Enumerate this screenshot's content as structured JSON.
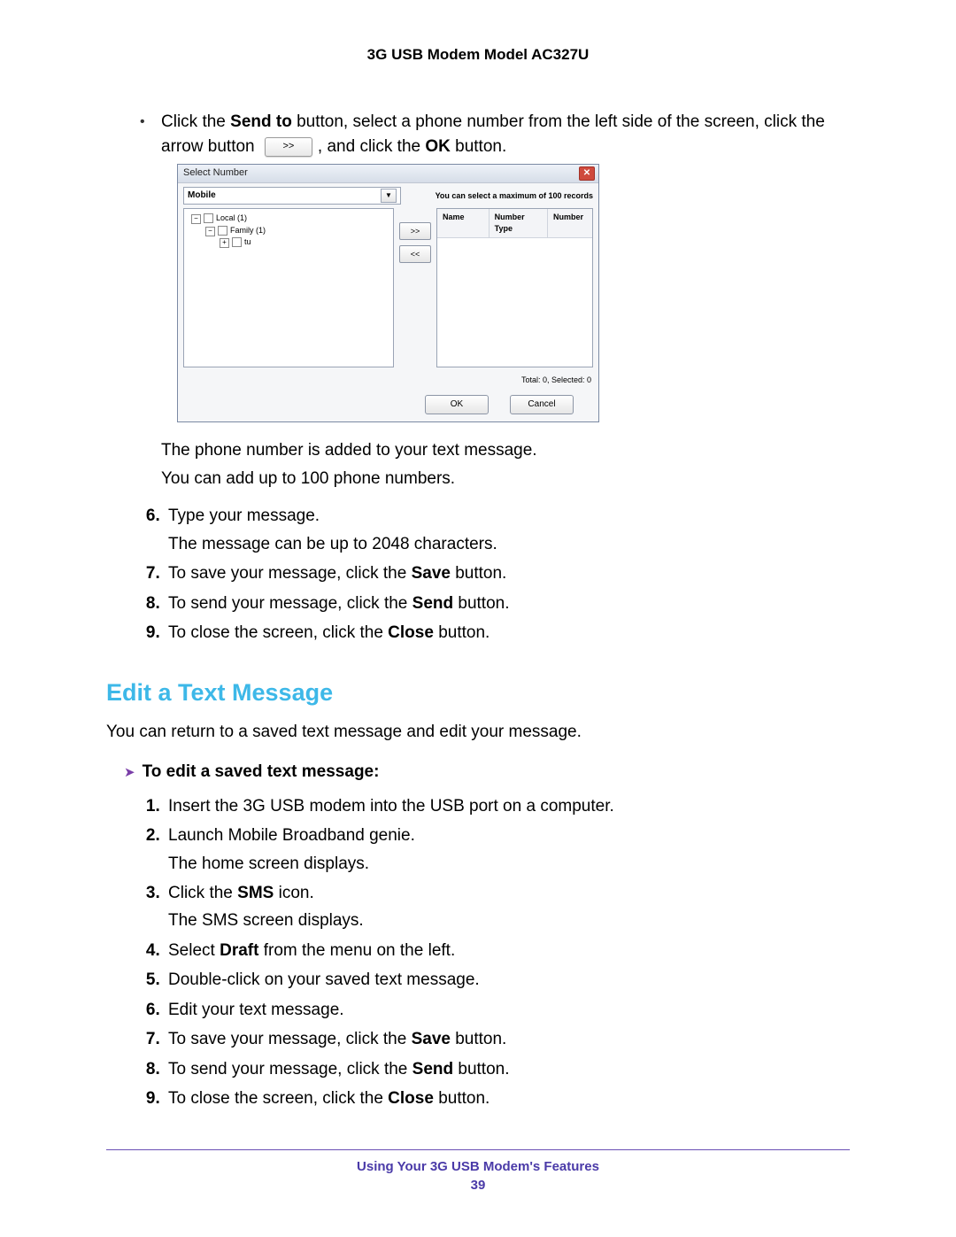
{
  "header": {
    "title": "3G USB Modem Model AC327U"
  },
  "intro_bullet": {
    "part1": "Click the ",
    "bold1": "Send to",
    "part2": " button, select a phone number from the left side of the screen, click the arrow button ",
    "part3": ", and click the ",
    "bold2": "OK",
    "part4": " button."
  },
  "dialog": {
    "title": "Select Number",
    "dropdown": "Mobile",
    "max_text": "You can select a maximum of  100 records",
    "tree": {
      "root": "Local (1)",
      "child": "Family (1)",
      "leaf": "tu"
    },
    "buttons": {
      "right": ">>",
      "left": "<<"
    },
    "cols": {
      "name": "Name",
      "type": "Number Type",
      "num": "Number"
    },
    "status": "Total: 0, Selected: 0",
    "ok": "OK",
    "cancel": "Cancel"
  },
  "post_dialog": {
    "l1": "The phone number is added to your text message.",
    "l2": "You can add up to 100 phone numbers."
  },
  "steps_a": {
    "s6a": "Type your message.",
    "s6b": "The message can be up to 2048 characters.",
    "s7a": "To save your message, click the ",
    "s7b": "Save",
    "s7c": " button.",
    "s8a": "To send your message, click the ",
    "s8b": "Send",
    "s8c": " button.",
    "s9a": "To close the screen, click the ",
    "s9b": "Close",
    "s9c": " button."
  },
  "section": {
    "heading": "Edit a Text Message",
    "intro": "You can return to a saved text message and edit your message."
  },
  "task": {
    "label": "To edit a saved text message:"
  },
  "steps_b": {
    "s1": "Insert the 3G USB modem into the USB port on a computer.",
    "s2a": "Launch Mobile Broadband genie.",
    "s2b": "The home screen displays.",
    "s3a": "Click the ",
    "s3b": "SMS",
    "s3c": " icon.",
    "s3d": "The SMS screen displays.",
    "s4a": "Select ",
    "s4b": "Draft",
    "s4c": " from the menu on the left.",
    "s5": "Double-click on your saved text message.",
    "s6": "Edit your text message.",
    "s7a": "To save your message, click the ",
    "s7b": "Save",
    "s7c": " button.",
    "s8a": "To send your message, click the ",
    "s8b": "Send",
    "s8c": " button.",
    "s9a": "To close the screen, click the ",
    "s9b": "Close",
    "s9c": " button."
  },
  "footer": {
    "text": "Using Your 3G USB Modem's Features",
    "page": "39"
  }
}
